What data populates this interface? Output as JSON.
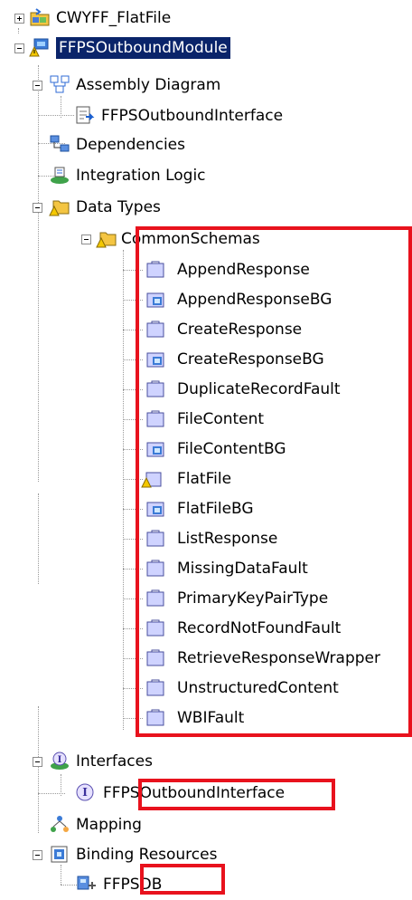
{
  "tree": {
    "projects": [
      {
        "label": "CWYFF_FlatFile"
      },
      {
        "label": "FFPSOutboundModule"
      }
    ],
    "module": {
      "assembly_diagram": "Assembly Diagram",
      "assembly_child": "FFPSOutboundInterface",
      "dependencies": "Dependencies",
      "integration_logic": "Integration Logic",
      "data_types": "Data Types",
      "common_schemas": "CommonSchemas",
      "business_objects": [
        "AppendResponse",
        "AppendResponseBG",
        "CreateResponse",
        "CreateResponseBG",
        "DuplicateRecordFault",
        "FileContent",
        "FileContentBG",
        "FlatFile",
        "FlatFileBG",
        "ListResponse",
        "MissingDataFault",
        "PrimaryKeyPairType",
        "RecordNotFoundFault",
        "RetrieveResponseWrapper",
        "UnstructuredContent",
        "WBIFault"
      ],
      "interfaces": "Interfaces",
      "interface_child": "FFPSOutboundInterface",
      "mapping": "Mapping",
      "binding_resources": "Binding Resources",
      "binding_child": "FFPSDB"
    }
  },
  "colors": {
    "selection": "#0a246a",
    "highlight_box": "#e8121d"
  }
}
